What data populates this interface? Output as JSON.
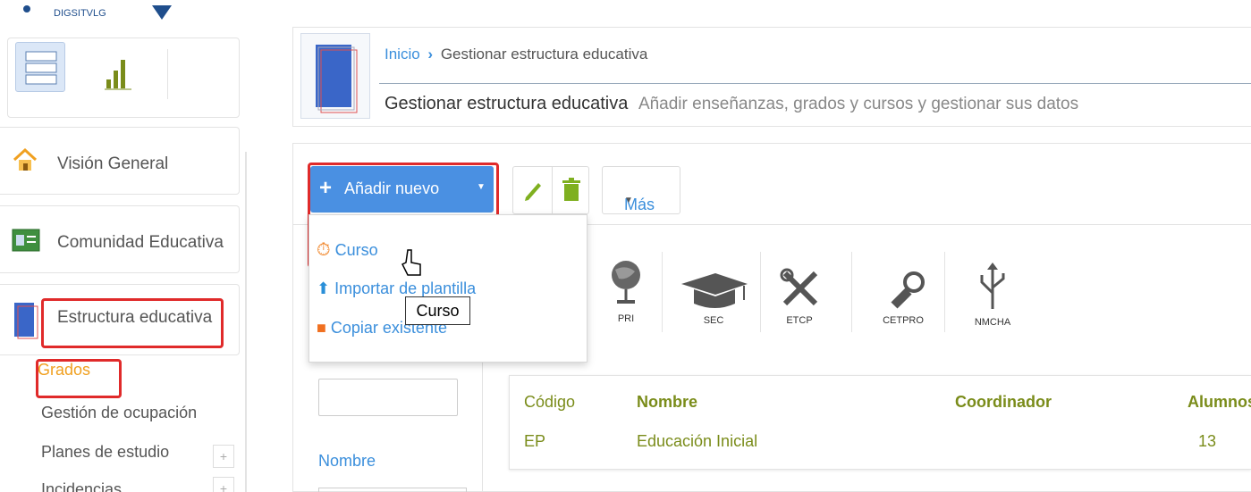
{
  "sidebar": {
    "logo_text": "DIGSITVLG",
    "items": [
      {
        "label": "Visión General"
      },
      {
        "label": "Comunidad Educativa"
      },
      {
        "label": "Estructura educativa"
      }
    ],
    "subitems": [
      {
        "label": "Grados"
      },
      {
        "label": "Gestión de ocupación"
      },
      {
        "label": "Planes de estudio"
      },
      {
        "label": "Incidencias"
      }
    ],
    "plus_symbol": "+"
  },
  "header": {
    "breadcrumb_home": "Inicio",
    "breadcrumb_separator": "›",
    "breadcrumb_current": "Gestionar estructura educativa",
    "title": "Gestionar estructura educativa",
    "subtitle": "Añadir enseñanzas, grados y cursos y gestionar sus datos"
  },
  "toolbar": {
    "add_new_label": "Añadir nuevo",
    "more_label": "Más"
  },
  "dropdown": {
    "items": [
      {
        "label": "Curso"
      },
      {
        "label": "Importar de plantilla"
      },
      {
        "label": "Copiar existente"
      }
    ]
  },
  "tooltip": "Curso",
  "levels": [
    {
      "code": "PRI"
    },
    {
      "code": "SEC"
    },
    {
      "code": "ETCP"
    },
    {
      "code": "CETPRO"
    },
    {
      "code": "NMCHA"
    }
  ],
  "filters": {
    "name_label": "Nombre"
  },
  "table": {
    "headers": [
      "Código",
      "Nombre",
      "Coordinador",
      "Alumnos"
    ],
    "rows": [
      {
        "codigo": "EP",
        "nombre": "Educación Inicial",
        "coordinador": "",
        "alumnos": "13"
      }
    ]
  },
  "colors": {
    "accent": "#4a90e2",
    "link": "#3b8fdc",
    "active": "#f0a020",
    "highlight": "#e02a2a",
    "header_green": "#7a8c1a"
  }
}
